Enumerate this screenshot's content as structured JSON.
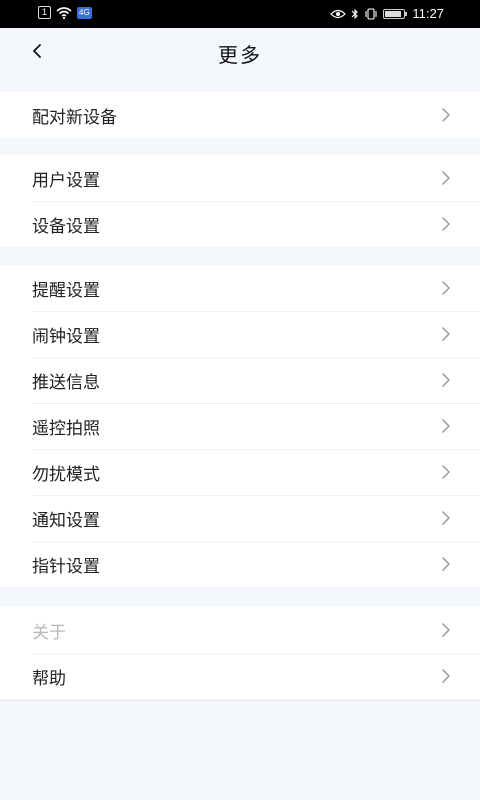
{
  "status_bar": {
    "sim_label": "1",
    "data_label": "4G",
    "time": "11:27"
  },
  "header": {
    "title": "更多",
    "back_icon": "chevron-left-icon"
  },
  "groups": [
    {
      "items": [
        {
          "label": "配对新设备"
        }
      ]
    },
    {
      "items": [
        {
          "label": "用户设置"
        },
        {
          "label": "设备设置"
        }
      ]
    },
    {
      "items": [
        {
          "label": "提醒设置"
        },
        {
          "label": "闹钟设置"
        },
        {
          "label": "推送信息"
        },
        {
          "label": "遥控拍照"
        },
        {
          "label": "勿扰模式"
        },
        {
          "label": "通知设置"
        },
        {
          "label": "指针设置"
        }
      ]
    },
    {
      "items": [
        {
          "label": "关于"
        },
        {
          "label": "帮助"
        }
      ]
    }
  ],
  "colors": {
    "background": "#f4f8fd",
    "item_background": "#ffffff",
    "text": "#222222",
    "text_disabled": "#b8b8b8",
    "chevron": "#9a9a9a"
  }
}
